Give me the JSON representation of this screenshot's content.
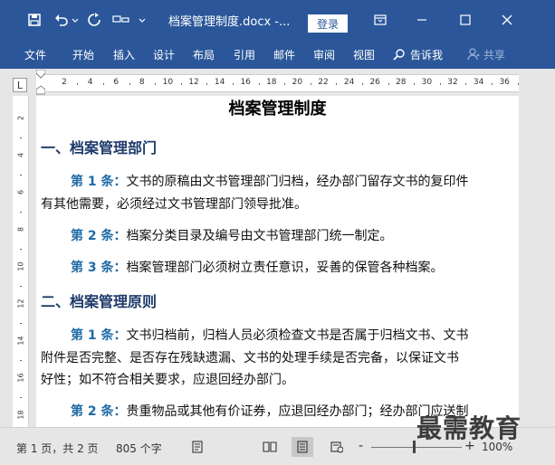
{
  "titlebar": {
    "title": "档案管理制度.docx  -...",
    "login_label": "登录"
  },
  "ribbon": {
    "tabs": [
      "文件",
      "开始",
      "插入",
      "设计",
      "布局",
      "引用",
      "邮件",
      "审阅",
      "视图"
    ],
    "tell_me": "告诉我",
    "share": "共享"
  },
  "ruler": {
    "tab_selector": "L",
    "numbers": [
      "2",
      "4",
      "6",
      "8",
      "10",
      "12",
      "14",
      "16",
      "18",
      "20",
      "22",
      "24",
      "26",
      "28",
      "30",
      "32",
      "34",
      "36"
    ]
  },
  "vruler": {
    "numbers": [
      "2",
      "4",
      "6",
      "8",
      "10",
      "12",
      "14",
      "16",
      "18"
    ]
  },
  "document": {
    "title": "档案管理制度",
    "heading1": "一、档案管理部门",
    "s1a1_label": "第 1 条：",
    "s1a1_line1": "文书的原稿由文书管理部门归档，经办部门留存文书的复印件",
    "s1a1_line2": "有其他需要，必须经过文书管理部门领导批准。",
    "s1a2_label": "第 2 条：",
    "s1a2_text": "档案分类目录及编号由文书管理部门统一制定。",
    "s1a3_label": "第 3 条：",
    "s1a3_text": "档案管理部门必须树立责任意识，妥善的保管各种档案。",
    "heading2": "二、档案管理原则",
    "s2a1_label": "第 1 条：",
    "s2a1_line1": "文书归档前，归档人员必须检查文书是否属于归档文书、文书",
    "s2a1_line2": "附件是否完整、是否存在残缺遗漏、文书的处理手续是否完备，以保证文书",
    "s2a1_line3": "好性；如不符合相关要求，应退回经办部门。",
    "s2a2_label": "第 2 条：",
    "s2a2_text": "贵重物品或其他有价证券，应退回经办部门；经办部门应送制"
  },
  "statusbar": {
    "page_info": "第 1 页，共 2 页",
    "word_count": "805 个字",
    "zoom_minus": "-",
    "zoom_plus": "+",
    "zoom_level": "100%"
  },
  "watermark": "最需教育",
  "colors": {
    "brand": "#2b579a",
    "heading": "#1e3a6a",
    "article_label": "#1f6aa5"
  }
}
